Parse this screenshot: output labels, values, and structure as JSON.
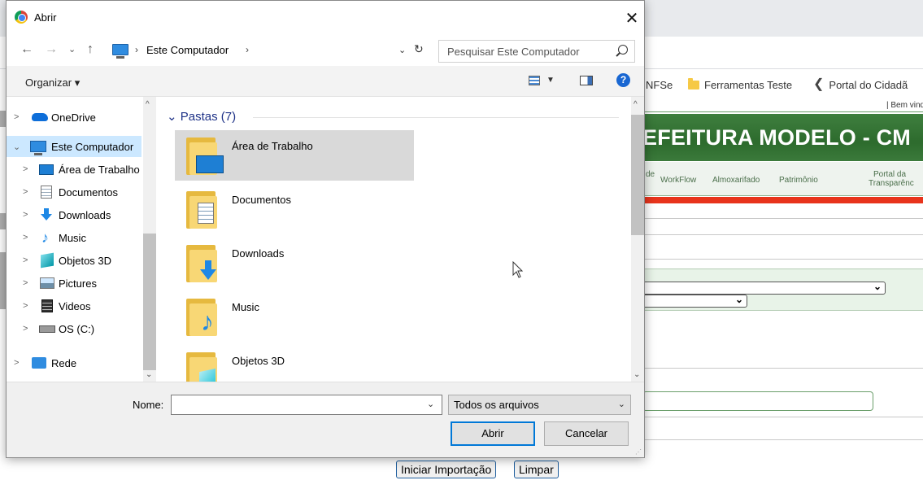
{
  "background_page": {
    "bookmarks": [
      "NFSe",
      "Ferramentas Teste",
      "Portal do Cidadã"
    ],
    "welcome": "| Bem vindo S",
    "banner_title": "EFEITURA MODELO - CM",
    "menu": [
      "de",
      "WorkFlow",
      "Almoxarifado",
      "Patrimônio",
      "Portal da",
      "Transparênc"
    ],
    "buttons": {
      "start_import": "Iniciar Importação",
      "clear": "Limpar"
    }
  },
  "dialog": {
    "title": "Abrir",
    "close_glyph": "✕",
    "nav": {
      "back": "←",
      "forward": "→",
      "recent": "⌄",
      "up": "↑"
    },
    "address": {
      "path": "Este Computador",
      "separator": "›",
      "dropdown": "⌄",
      "refresh": "↻"
    },
    "search": {
      "placeholder": "Pesquisar Este Computador"
    },
    "toolbar": {
      "organize": "Organizar ▾",
      "view_dd": "▼",
      "help": "?"
    },
    "tree": [
      {
        "label": "OneDrive",
        "icon": "onedrive-icon",
        "expander": ">"
      },
      {
        "label": "Este Computador",
        "icon": "computer-icon",
        "expander": "⌄",
        "selected": true
      },
      {
        "label": "Área de Trabalho",
        "icon": "desktop-icon",
        "expander": ">"
      },
      {
        "label": "Documentos",
        "icon": "documents-icon",
        "expander": ">"
      },
      {
        "label": "Downloads",
        "icon": "downloads-icon",
        "expander": ">"
      },
      {
        "label": "Music",
        "icon": "music-icon",
        "expander": ">"
      },
      {
        "label": "Objetos 3D",
        "icon": "3d-objects-icon",
        "expander": ">"
      },
      {
        "label": "Pictures",
        "icon": "pictures-icon",
        "expander": ">"
      },
      {
        "label": "Videos",
        "icon": "videos-icon",
        "expander": ">"
      },
      {
        "label": "OS (C:)",
        "icon": "drive-icon",
        "expander": ">"
      },
      {
        "label": "Rede",
        "icon": "network-icon",
        "expander": ">"
      }
    ],
    "content": {
      "group_header": "Pastas (7)",
      "group_chevron": "⌄",
      "folders": [
        {
          "name": "Área de Trabalho",
          "icon": "desktop-folder-icon",
          "selected": true
        },
        {
          "name": "Documentos",
          "icon": "documents-folder-icon"
        },
        {
          "name": "Downloads",
          "icon": "downloads-folder-icon"
        },
        {
          "name": "Music",
          "icon": "music-folder-icon"
        },
        {
          "name": "Objetos 3D",
          "icon": "3d-objects-folder-icon"
        }
      ]
    },
    "footer": {
      "name_label": "Nome:",
      "name_value": "",
      "name_dropdown": "⌄",
      "file_type": "Todos os arquivos",
      "file_type_dropdown": "⌄",
      "open_button": "Abrir",
      "cancel_button": "Cancelar"
    },
    "colors": {
      "selection": "#cce8ff",
      "folder_selected": "#d9d9d9",
      "primary_border": "#0078d7",
      "group_header": "#1e3287"
    }
  }
}
